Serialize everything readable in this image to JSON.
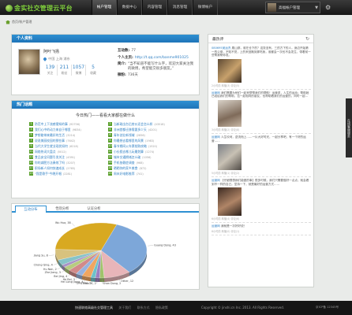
{
  "app": {
    "title": "金实社交管理云平台",
    "breadcrumb": "首页/帐户管理"
  },
  "nav": {
    "items": [
      {
        "label": "帐户管理"
      },
      {
        "label": "数据中心"
      },
      {
        "label": "内容管理"
      },
      {
        "label": "消息管理"
      },
      {
        "label": "微博帐户"
      }
    ]
  },
  "user": {
    "name": "高福帐户管理",
    "caret": "▼"
  },
  "profile": {
    "heading": "个人资料",
    "name": "阿叶飞扬",
    "location": "中国 上海 浦东",
    "stats": [
      {
        "num": "139",
        "label": "关注"
      },
      {
        "num": "211",
        "label": "粉丝"
      },
      {
        "num": "1057",
        "label": "微博"
      },
      {
        "num": "5",
        "label": "收藏"
      }
    ],
    "info": [
      {
        "k": "互动数:",
        "v": "77",
        "link": false
      },
      {
        "k": "个人主页:",
        "v": "http://t.qq.com/banme901025",
        "link": true
      },
      {
        "k": "简介:",
        "v": "“当不知道不能写什么字，欢迎大家关注我的微博，希望能交很多朋友。”",
        "link": false
      },
      {
        "k": "微粉:",
        "v": "736天",
        "link": false
      }
    ]
  },
  "hot": {
    "heading": "热门话题",
    "subtitle": "今日热门——看看大家都在做什么",
    "rows": [
      [
        {
          "n": "1",
          "t": "防范中上下流感需知的事",
          "c": "(92756)"
        },
        {
          "n": "2",
          "t": "当新政出台后房价还会怎么样",
          "c": "(43518)"
        }
      ],
      [
        {
          "n": "3",
          "t": "我们心中的动力来自于哪里",
          "c": "(9834)"
        },
        {
          "n": "4",
          "t": "非洲首都迁移需要多少天",
          "c": "(4201)"
        }
      ],
      [
        {
          "n": "5",
          "t": "梦想能带来最好的生活",
          "c": "(3214)"
        },
        {
          "n": "6",
          "t": "青年创业新领域",
          "c": "(2856)"
        }
      ],
      [
        {
          "n": "7",
          "t": "说说美丽校园的那些事",
          "c": "(7642)"
        },
        {
          "n": "8",
          "t": "你最想去看哪里的风景",
          "c": "(1983)"
        }
      ],
      [
        {
          "n": "9",
          "t": "当代大学生就业现状如何",
          "c": "(6218)"
        },
        {
          "n": "10",
          "t": "春节期间火车票抢购攻略",
          "c": "(1520)"
        }
      ],
      [
        {
          "n": "11",
          "t": "网络热词大盘点",
          "c": "(5012)"
        },
        {
          "n": "12",
          "t": "小长假去哪儿玩最划算",
          "c": "(1274)"
        }
      ],
      [
        {
          "n": "13",
          "t": "食品安全问题引发关注",
          "c": "(4391)"
        },
        {
          "n": "14",
          "t": "城市交通拥堵怎么破",
          "c": "(1056)"
        }
      ],
      [
        {
          "n": "15",
          "t": "你的减肥方法奏效了吗",
          "c": "(3207)"
        },
        {
          "n": "16",
          "t": "手机依赖症调查",
          "c": "(968)"
        }
      ],
      [
        {
          "n": "17",
          "t": "职场新人如何快速成长",
          "c": "(2765)"
        },
        {
          "n": "18",
          "t": "晒晒你的家乡美食",
          "c": "(872)"
        }
      ],
      [
        {
          "n": "19",
          "t": "\"我是歌手\"今晚开唱",
          "c": "(2281)"
        },
        {
          "n": "20",
          "t": "周末好电影推荐",
          "c": "(741)"
        }
      ]
    ]
  },
  "chart_tabs": [
    {
      "label": "互动分布"
    },
    {
      "label": "性别分析"
    },
    {
      "label": "认证分析"
    }
  ],
  "chart_data": {
    "type": "pie",
    "title": "",
    "slices": [
      {
        "label": "Guang Dong, 43",
        "value": 43
      },
      {
        "label": "Other, 12",
        "value": 12
      },
      {
        "label": "Shan Dong, 2",
        "value": 2
      },
      {
        "label": "Shan Xi, 2",
        "value": 2
      },
      {
        "label": "Qing Hai, 2",
        "value": 2
      },
      {
        "label": "Hei Long Jiang, 4",
        "value": 4
      },
      {
        "label": "He Bei, 3",
        "value": 3
      },
      {
        "label": "Bei Jing, 4",
        "value": 4
      },
      {
        "label": "Zhe Jiang, 3",
        "value": 3
      },
      {
        "label": "Hu Nan, 2",
        "value": 2
      },
      {
        "label": "Chong Qing, 4",
        "value": 4
      },
      {
        "label": "Jiang Su, 8",
        "value": 8
      },
      {
        "label": "Wu Hua, 38",
        "value": 38
      }
    ],
    "colors": [
      "#7da7d9",
      "#e8b5b9",
      "#a0c36b",
      "#9b7fc1",
      "#6cc2c9",
      "#f0a660",
      "#97b2de",
      "#d28a8a",
      "#b6cc7f",
      "#a893c7",
      "#86c3c8",
      "#d8c27e",
      "#d8a921"
    ]
  },
  "right": {
    "heading": "最热评",
    "refresh": "↻",
    "feed": [
      {
        "who": "080695吴运杰",
        "text": "爬山那，谁在仓下的？这张没有，三的方下的人，身边开始第一的父母，不知不觉，上的来回跑到那吃我，谁都会一次也不会发生，带着前一些帮我帮你发。",
        "meta": "2小时前  转播(3)  评论(5)"
      },
      {
        "who": "运营网",
        "text": "我们需要为他们一起来帮帮我们的帮助！运营求，人生的运动；帮助她已经给我们的帮助，拉一起相同的朋友，也帮助着我们的运营的，同时一起…",
        "meta": "3小时前  转播(2)  评论(8)"
      },
      {
        "who": "运营网",
        "text": "人生坎坷，逆流而上……一片大好时光，一起分享吧，有一个好的运营……",
        "meta": "5小时前  转播(1)  评论(2)"
      },
      {
        "who": "运营网",
        "text": "【仔细想想我们能做的事】很多时候，我们只需要做好一点点，就会看到不一样的自己。坚持一下，就是最好的运营方式……",
        "meta": "6小时前  转播(4)  评论(6)"
      },
      {
        "who": "运营网",
        "text": "我就是一次好好说！",
        "meta": "8小时前  转播(0)  评论(1)"
      }
    ]
  },
  "sidetab": {
    "label": "在线客服服务"
  },
  "footer": {
    "left": "快速联络高级社交管理工具",
    "links": [
      "关于我们",
      "联系方式",
      "隐私政策"
    ],
    "mid": "Copyright © jinshi.cn Inc. 2013. All Rights Reserved.",
    "right": "京ICP备 12345号"
  }
}
